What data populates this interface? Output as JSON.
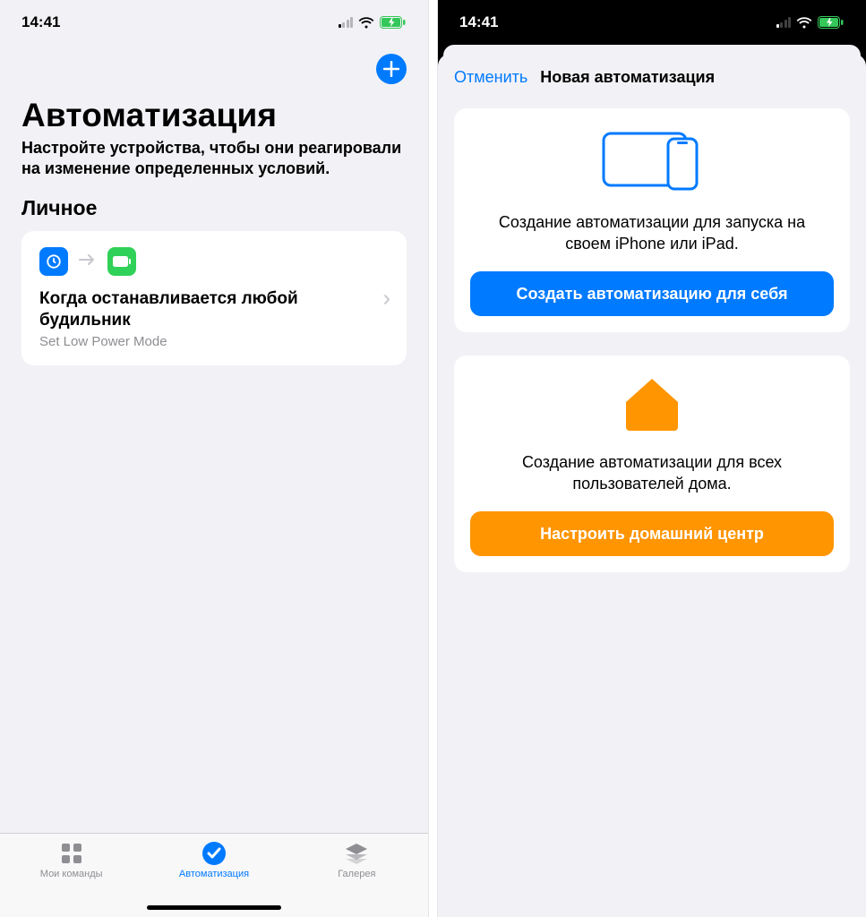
{
  "status": {
    "time": "14:41"
  },
  "left": {
    "title": "Автоматизация",
    "desc": "Настройте устройства, чтобы они реагировали на изменение определенных условий.",
    "section": "Личное",
    "automation": {
      "title": "Когда останавливается любой будильник",
      "subtitle": "Set Low Power Mode"
    },
    "tabs": {
      "my": "Мои команды",
      "auto": "Автоматизация",
      "gallery": "Галерея"
    }
  },
  "right": {
    "cancel": "Отменить",
    "title": "Новая автоматизация",
    "personal": {
      "desc": "Создание автоматизации для запуска на своем iPhone или iPad.",
      "button": "Создать автоматизацию для себя"
    },
    "home": {
      "desc": "Создание автоматизации для всех пользователей дома.",
      "button": "Настроить домашний центр"
    }
  }
}
